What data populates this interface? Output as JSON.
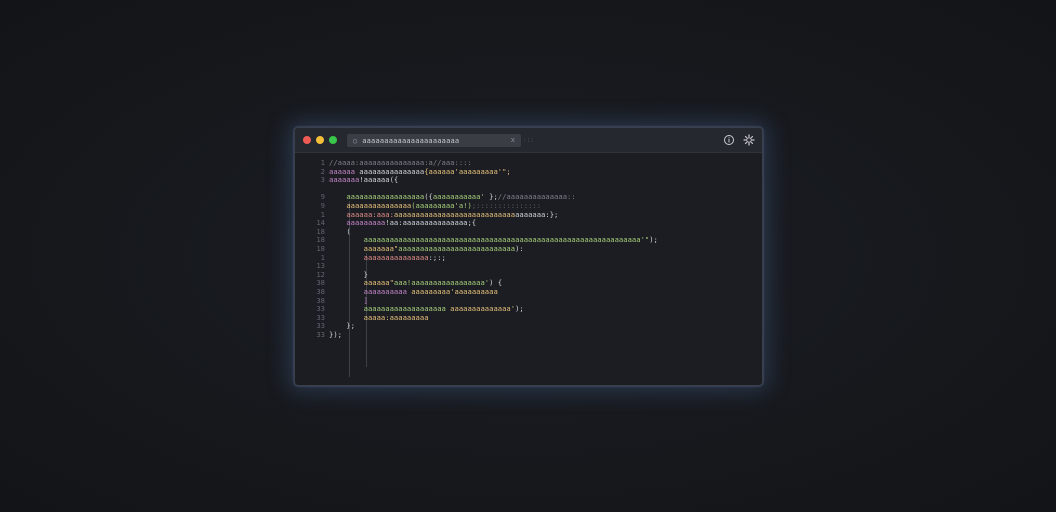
{
  "window": {
    "address_text": "aaaaaaaaaaaaaaaaaaaaaa",
    "address_lock": "○",
    "address_end": "x",
    "address_tail": ":::",
    "icons": [
      "info-icon",
      "gear-icon"
    ]
  },
  "colors": {
    "close": "#ee5b55",
    "minimize": "#f3be3a",
    "maximize": "#39c64a",
    "glow": "#5a82be"
  },
  "editor": {
    "line_numbers": [
      "1",
      "2",
      "3",
      "",
      "9",
      "9",
      "1",
      "14",
      "18",
      "18",
      "18",
      "1",
      "13",
      "12",
      "38",
      "38",
      "38",
      "33",
      "33",
      "33",
      "33"
    ],
    "lines": [
      [
        {
          "t": "//aaaa:aaaaaaaaaaaaaaa:a//aaa::::",
          "c": "c-cmt"
        }
      ],
      [
        {
          "t": "aaaaaa ",
          "c": "c-kw"
        },
        {
          "t": "aaaaaaaaaaaaaaa",
          "c": "c-txt"
        },
        {
          "t": "{aaaaaa'aaaaaaaaa'\";",
          "c": "c-fn"
        }
      ],
      [
        {
          "t": "aaaaaaa",
          "c": "c-kw"
        },
        {
          "t": "!aaaaaa({",
          "c": "c-txt"
        }
      ],
      [
        {
          "t": "",
          "c": "c-txt"
        }
      ],
      [
        {
          "t": "    ",
          "c": "c-txt"
        },
        {
          "t": "aaaaaaaaaaaaaaaaaa",
          "c": "c-str"
        },
        {
          "t": "({",
          "c": "c-txt"
        },
        {
          "t": "aaaaaaaaaaa'",
          "c": "c-str"
        },
        {
          "t": " };",
          "c": "c-txt"
        },
        {
          "t": "//aaaaaaaaaaaaaa::",
          "c": "c-cmt"
        }
      ],
      [
        {
          "t": "    ",
          "c": "c-txt"
        },
        {
          "t": "aaaaaaaaaaaaaaa",
          "c": "c-fn"
        },
        {
          "t": "(aaaaaaaaa'a!)",
          "c": "c-str"
        },
        {
          "t": ";:::::::::::::::",
          "c": "c-dim"
        }
      ],
      [
        {
          "t": "    ",
          "c": "c-txt"
        },
        {
          "t": "aaaaaa:aaa:",
          "c": "c-var"
        },
        {
          "t": "aaaaaaaaaaaaaaaaaaaaaaaaaaaa",
          "c": "c-fn"
        },
        {
          "t": "aaaaaaa",
          ".c": "c-txt",
          "c": "c-txt"
        },
        {
          "t": ":};",
          "c": "c-txt"
        }
      ],
      [
        {
          "t": "    ",
          "c": "c-txt"
        },
        {
          "t": "aaaaaaaaa",
          "c": "c-kw"
        },
        {
          "t": "!aa:aaaaaaaaaaaaaaa;{",
          "c": "c-txt"
        }
      ],
      [
        {
          "t": "    ",
          "c": "c-txt"
        },
        {
          "t": "(",
          "c": "c-txt"
        }
      ],
      [
        {
          "t": "        ",
          "c": "c-txt"
        },
        {
          "t": "aaaaaaaaaaaaaaaaaaaaaaaaaaaaaaaaaaaaaaaaaaaaaaaaaaaaaaaaaaaaaaaa'\"",
          "c": "c-str"
        },
        {
          "t": ");",
          "c": "c-txt"
        }
      ],
      [
        {
          "t": "        ",
          "c": "c-txt"
        },
        {
          "t": "aaaaaaa\"",
          "c": "c-fn"
        },
        {
          "t": "aaaaaaaaaaaaaaaaaaaaaaaaaaa",
          "c": "c-str"
        },
        {
          "t": "):",
          "c": "c-txt"
        }
      ],
      [
        {
          "t": "        ",
          "c": "c-txt"
        },
        {
          "t": "aaaaaaaaaaaaaaa",
          "c": "c-var"
        },
        {
          "t": ":;:;",
          "c": "c-txt"
        }
      ],
      [
        {
          "t": "",
          "c": "c-txt"
        }
      ],
      [
        {
          "t": "        }",
          "c": "c-txt"
        }
      ],
      [
        {
          "t": "        ",
          "c": "c-txt"
        },
        {
          "t": "aaaaaa\"",
          "c": "c-fn"
        },
        {
          "t": "aaa!aaaaaaaaaaaaaaaaa'",
          "c": "c-str"
        },
        {
          "t": ") {",
          "c": "c-txt"
        }
      ],
      [
        {
          "t": "        ",
          "c": "c-txt"
        },
        {
          "t": "aaaaaaaaaa ",
          "c": "c-kw"
        },
        {
          "t": "aaaaaaaaa'aaaaaaaaaa",
          "c": "c-fn"
        }
      ],
      [
        {
          "t": "        ",
          "c": "c-txt"
        },
        {
          "t": "]",
          "c": "c-kw"
        }
      ],
      [
        {
          "t": "        ",
          "c": "c-txt"
        },
        {
          "t": "aaaaaaaaaaaaaaaaaaa ",
          "c": "c-str"
        },
        {
          "t": "aaaaaaaaaaaaaa'",
          "c": "c-fn"
        },
        {
          "t": ");",
          "c": "c-txt"
        }
      ],
      [
        {
          "t": "        ",
          "c": "c-txt"
        },
        {
          "t": "aaaaa:aaaaaaaaa",
          "c": "c-fn"
        }
      ],
      [
        {
          "t": "    };",
          "c": "c-txt"
        }
      ],
      [
        {
          "t": "});",
          "c": "c-txt"
        }
      ]
    ]
  }
}
